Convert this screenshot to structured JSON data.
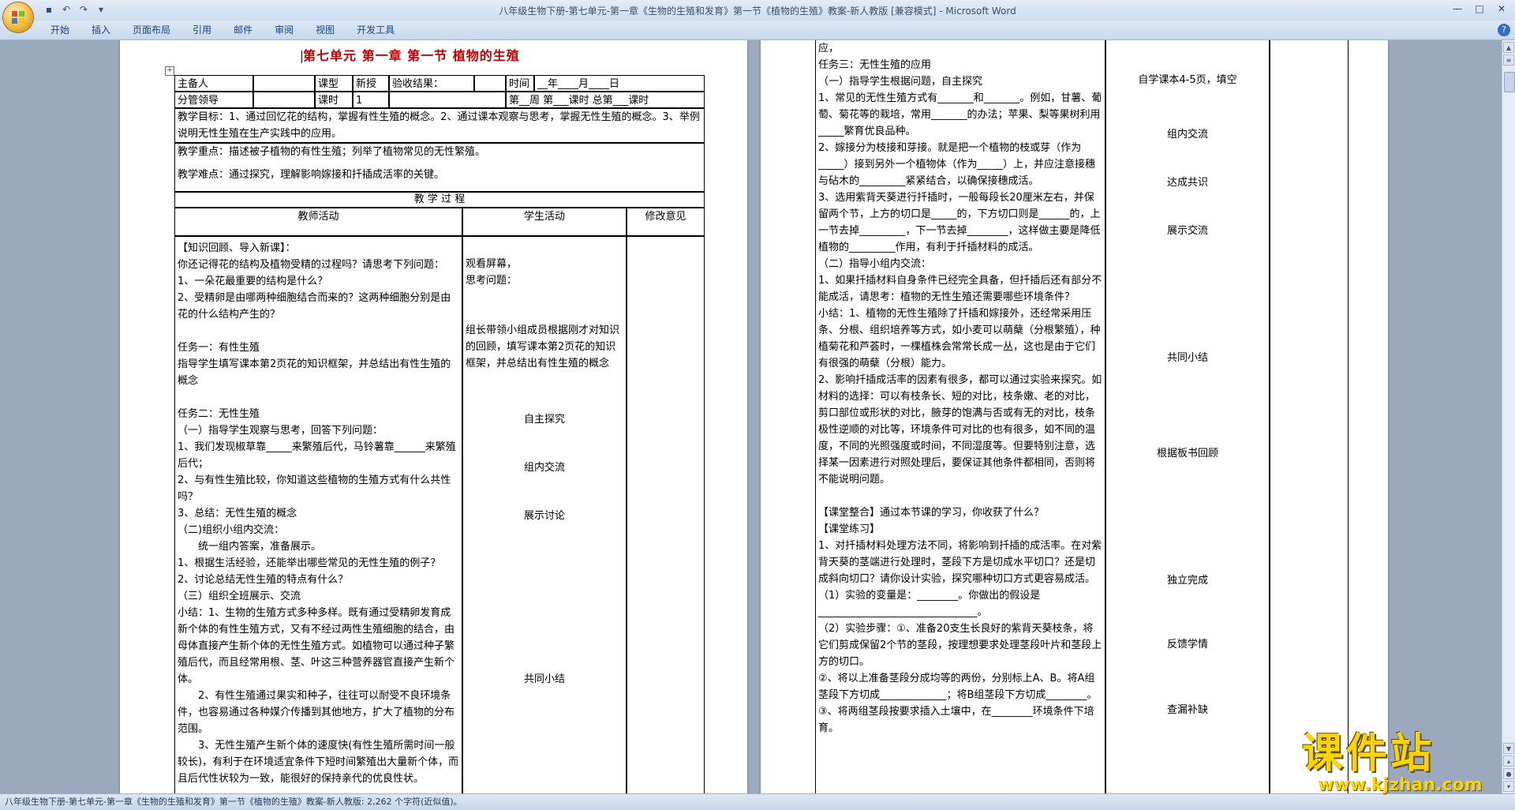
{
  "window": {
    "title": "八年级生物下册-第七单元-第一章《生物的生殖和发育》第一节《植物的生殖》教案-新人教版 [兼容模式] - Microsoft Word",
    "qat": {
      "save_icon": "save-icon",
      "undo_icon": "undo-icon",
      "redo_icon": "redo-icon",
      "customize_icon": "chevron-down-icon"
    },
    "controls": {
      "minimize": "—",
      "maximize": "□",
      "close": "✕"
    }
  },
  "ribbon": {
    "tabs": [
      "开始",
      "插入",
      "页面布局",
      "引用",
      "邮件",
      "审阅",
      "视图",
      "开发工具"
    ],
    "help": "?"
  },
  "status_bar": {
    "text": "八年级生物下册-第七单元-第一章《生物的生殖和发育》第一节《植物的生殖》教案-新人教版: 2,262 个字符(近似值)。"
  },
  "watermark": {
    "main": "课件站",
    "url": "www.kjzhan.com"
  },
  "page1": {
    "title": "第七单元  第一章  第一节  植物的生殖",
    "header": {
      "r1": [
        "主备人",
        "课型",
        "新授",
        "验收结果：",
        "时间",
        "__年____月____日"
      ],
      "r2": [
        "分管领导",
        "课时",
        "1",
        "第__周  第___课时  总第___课时"
      ]
    },
    "goals": "教学目标：1、通过回忆花的结构，掌握有性生殖的概念。2、通过课本观察与思考，掌握无性生殖的概念。3、举例说明无性生殖在生产实践中的应用。",
    "key_points": "教学重点：描述被子植物的有性生殖；列举了植物常见的无性繁殖。",
    "difficult": "教学难点：通过探究，理解影响嫁接和扦插成活率的关键。",
    "process_label": "教          学          过          程",
    "col_headers": [
      "教师活动",
      "学生活动",
      "修改意见"
    ],
    "teacher": [
      "【知识回顾、导入新课】：",
      "你还记得花的结构及植物受精的过程吗？请思考下列问题：",
      "1、一朵花最重要的结构是什么？",
      "2、受精卵是由哪两种细胞结合而来的？这两种细胞分别是由花的什么结构产生的？",
      "",
      "任务一：有性生殖",
      "指导学生填写课本第2页花的知识框架，并总结出有性生殖的概念",
      "",
      "任务二：无性生殖",
      "（一）指导学生观察与思考，回答下列问题：",
      "1、我们发现椒草靠_____来繁殖后代，马铃薯靠______来繁殖后代；",
      "2、与有性生殖比较，你知道这些植物的生殖方式有什么共性吗？",
      "3、总结：无性生殖的概念",
      "（二)组织小组内交流：",
      "统一组内答案，准备展示。",
      "1、根据生活经验，还能举出哪些常见的无性生殖的例子？",
      "2、讨论总结无性生殖的特点有什么？",
      "（三）组织全班展示、交流",
      "小结：1、生物的生殖方式多种多样。既有通过受精卵发育成新个体的有性生殖方式，又有不经过两性生殖细胞的结合，由母体直接产生新个体的无性生殖方式。如植物可以通过种子繁殖后代，而且经常用根、茎、叶这三种营养器官直接产生新个体。",
      "2、有性生殖通过果实和种子，往往可以耐受不良环境条件，也容易通过各种媒介传播到其他地方，扩大了植物的分布范围。",
      "3、无性生殖产生新个体的速度快(有性生殖所需时间一般较长)，有利于在环境适宜条件下短时间繁殖出大量新个体，而且后代性状较为一致，能很好的保持亲代的优良性状。"
    ],
    "student": [
      "观看屏幕，",
      "思考问题：",
      "组长带领小组成员根据刚才对知识的回顾，填写课本第2页花的知识框架，并总结出有性生殖的概念",
      "自主探究",
      "组内交流",
      "展示讨论",
      "共同小结"
    ]
  },
  "page2": {
    "main": [
      "应，",
      "任务三：无性生殖的应用",
      "（一）指导学生根据问题，自主探究",
      "1、常见的无性生殖方式有_______和_______。例如，甘薯、葡萄、菊花等的栽培，常用_______的办法；苹果、梨等果树利用_____繁育优良品种。",
      "2、嫁接分为枝接和芽接。就是把一个植物的枝或芽（作为_____）接到另外一个植物体（作为_____）上，并应注意接穗与砧木的_________紧紧结合，以确保接穗成活。",
      "3、选用紫背天葵进行扦插时，一般每段长20厘米左右，并保留两个节，上方的切口是_____的，下方切口则是______的，上一节去掉_________，下一节去掉________，这样做主要是降低植物的_________作用，有利于扦插材料的成活。",
      "（二）指导小组内交流：",
      "1、如果扦插材料自身条件已经完全具备，但扦插后还有部分不能成活，请思考：植物的无性生殖还需要哪些环境条件？",
      "小结：1、植物的无性生殖除了扦插和嫁接外，还经常采用压条、分根、组织培养等方式，如小麦可以萌蘖（分根繁殖），种植菊花和芦荟时，一棵植株会常常长成一丛，这也是由于它们有很强的萌蘖（分根）能力。",
      "2、影响扦插成活率的因素有很多，都可以通过实验来探究。如材料的选择：可以有枝条长、短的对比，枝条嫩、老的对比，剪口部位或形状的对比，腋芽的饱满与否或有无的对比，枝条极性逆顺的对比等，环境条件可对比的也有很多，如不同的温度，不同的光照强度或时间，不同湿度等。但要特别注意，选择某一因素进行对照处理后，要保证其他条件都相同，否则将不能说明问题。",
      "",
      "【课堂整合】通过本节课的学习，你收获了什么？",
      "【课堂练习】",
      "1、对扦插材料处理方法不同，将影响到扦插的成活率。在对紫背天葵的茎端进行处理时，茎段下方是切成水平切口？还是切成斜向切口？请你设计实验，探究哪种切口方式更容易成活。",
      "（1）实验的变量是：________。你做出的假设是_______________________________。",
      "（2）实验步骤：①、准备20支生长良好的紫背天葵枝条，将它们剪成保留2个节的茎段，按理想要求处理茎段叶片和茎段上方的切口。",
      "②、将以上准备茎段分成均等的两份，分别标上A、B。将A组茎段下方切成_____________；将B组茎段下方切成________。",
      "③、将两组茎段按要求插入土壤中，在________环境条件下培育。"
    ],
    "side": [
      "自学课本4-5页，填空",
      "组内交流",
      "达成共识",
      "展示交流",
      "共同小结",
      "根据板书回顾",
      "独立完成",
      "反馈学情",
      "查漏补缺"
    ]
  }
}
